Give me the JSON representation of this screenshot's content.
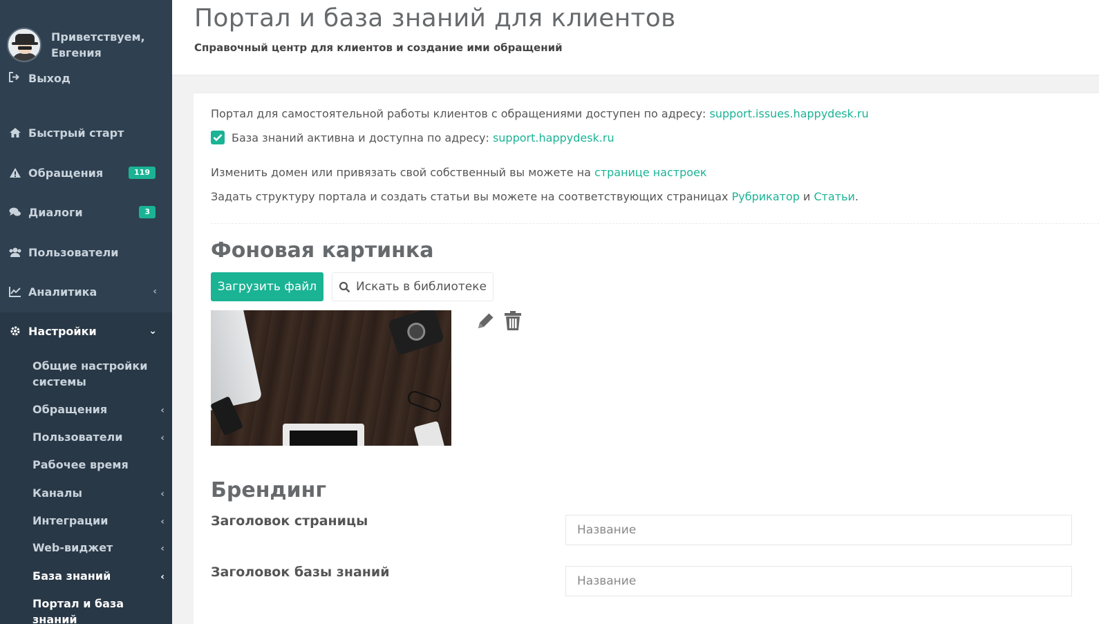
{
  "sidebar": {
    "greeting": "Приветствуем,\nЕвгения",
    "logout_label": "Выход",
    "items": [
      {
        "label": "Быстрый старт",
        "icon": "home-icon"
      },
      {
        "label": "Обращения",
        "icon": "warning-icon",
        "badge": "119"
      },
      {
        "label": "Диалоги",
        "icon": "chat-icon",
        "badge": "3"
      },
      {
        "label": "Пользователи",
        "icon": "users-icon"
      },
      {
        "label": "Аналитика",
        "icon": "chart-line-icon"
      },
      {
        "label": "Настройки",
        "icon": "gear-icon"
      }
    ],
    "sub_items": [
      {
        "label": "Общие настройки системы"
      },
      {
        "label": "Обращения"
      },
      {
        "label": "Пользователи"
      },
      {
        "label": "Рабочее время"
      },
      {
        "label": "Каналы"
      },
      {
        "label": "Интеграции"
      },
      {
        "label": "Web-виджет"
      },
      {
        "label": "База знаний"
      },
      {
        "label": "Портал и база знаний"
      }
    ]
  },
  "header": {
    "title": "Портал и база знаний для клиентов",
    "subtitle": "Справочный центр для клиентов и создание ими обращений"
  },
  "content": {
    "portal_text": "Портал для самостоятельной работы клиентов с обращениями доступен по адресу: ",
    "portal_link": "support.issues.happydesk.ru",
    "kb_text": "База знаний активна и доступна по адресу: ",
    "kb_link": "support.happydesk.ru",
    "domain_text": "Изменить домен или привязать свой собственный вы можете на ",
    "domain_link": "странице настроек",
    "structure_text": "Задать структуру портала и создать статьи вы можете на соответствующих страницах ",
    "structure_link1": "Рубрикатор",
    "structure_and": " и ",
    "structure_link2": "Статьи",
    "structure_dot": ".",
    "bg_section_title": "Фоновая картинка",
    "upload_button": "Загрузить файл",
    "library_button": "Искать в библиотеке",
    "branding_title": "Брендинг",
    "page_title_label": "Заголовок страницы",
    "page_title_placeholder": "Название",
    "kb_title_label": "Заголовок базы знаний",
    "kb_title_placeholder": "Название"
  },
  "colors": {
    "accent": "#1ab394",
    "sidebar_bg": "#2f4050"
  }
}
